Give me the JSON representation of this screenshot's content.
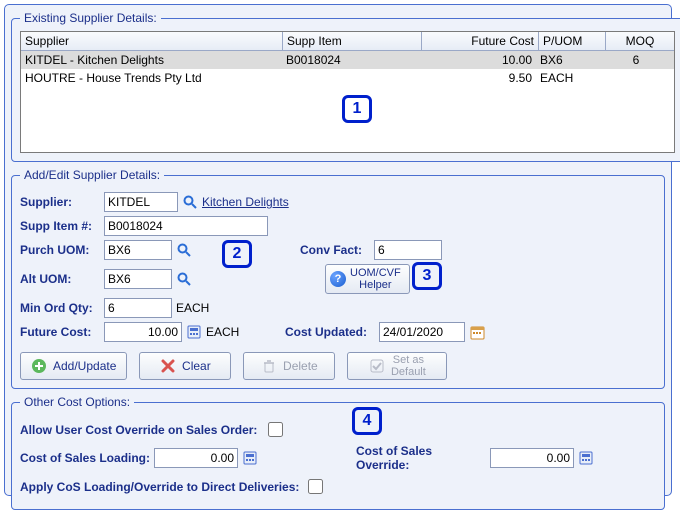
{
  "existing": {
    "legend": "Existing Supplier Details:",
    "headers": {
      "supplier": "Supplier",
      "supp_item": "Supp Item",
      "future_cost": "Future Cost",
      "p_uom": "P/UOM",
      "moq": "MOQ"
    },
    "rows": [
      {
        "supplier": "KITDEL - Kitchen Delights",
        "supp_item": "B0018024",
        "future_cost": "10.00",
        "p_uom": "BX6",
        "moq": "6",
        "selected": true
      },
      {
        "supplier": "HOUTRE - House Trends Pty Ltd",
        "supp_item": "",
        "future_cost": "9.50",
        "p_uom": "EACH",
        "moq": "",
        "selected": false
      }
    ]
  },
  "edit": {
    "legend": "Add/Edit Supplier Details:",
    "labels": {
      "supplier": "Supplier:",
      "supp_item": "Supp Item #:",
      "purch_uom": "Purch UOM:",
      "alt_uom": "Alt UOM:",
      "min_ord_qty": "Min Ord Qty:",
      "future_cost": "Future Cost:",
      "conv_fact": "Conv Fact:",
      "cost_updated": "Cost Updated:"
    },
    "values": {
      "supplier_code": "KITDEL",
      "supplier_name": "Kitchen Delights",
      "supp_item": "B0018024",
      "purch_uom": "BX6",
      "alt_uom": "BX6",
      "min_ord_qty": "6",
      "min_ord_qty_unit": "EACH",
      "future_cost": "10.00",
      "future_cost_unit": "EACH",
      "conv_fact": "6",
      "cost_updated": "24/01/2020"
    },
    "uom_helper": "UOM/CVF\nHelper",
    "buttons": {
      "add_update": "Add/Update",
      "clear": "Clear",
      "delete": "Delete",
      "set_default": "Set as\nDefault"
    }
  },
  "options": {
    "legend": "Other Cost Options:",
    "labels": {
      "allow_override": "Allow User Cost Override on Sales Order:",
      "loading": "Cost of Sales Loading:",
      "override": "Cost of Sales Override:",
      "apply_direct": "Apply CoS Loading/Override to Direct Deliveries:"
    },
    "values": {
      "allow_override": false,
      "loading": "0.00",
      "override": "0.00",
      "apply_direct": false
    }
  },
  "callouts": {
    "1": "1",
    "2": "2",
    "3": "3",
    "4": "4"
  }
}
